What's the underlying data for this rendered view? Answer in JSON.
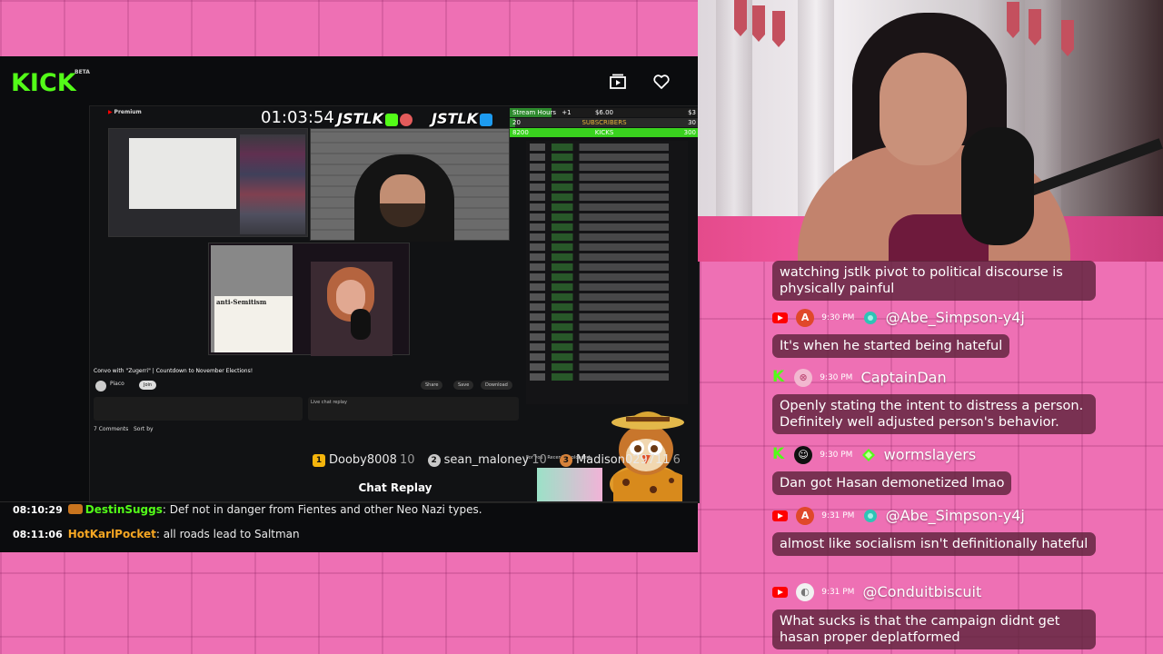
{
  "kick_player": {
    "logo": "KICK",
    "logo_badge": "BETA",
    "icons": {
      "theatre": "theatre-mode-icon",
      "follow": "heart-icon"
    },
    "video": {
      "yt_brand": "Premium",
      "timer": "01:03:54",
      "tag_kick": "JSTLK",
      "tag_twitter": "JSTLK",
      "goals": {
        "hours_label": "Stream Hours",
        "hours_extra": "+1",
        "hours_mid": "$6.00",
        "hours_right": "$3",
        "subs_left": "20",
        "subs_label": "SUBSCRIBERS",
        "subs_right": "30",
        "kicks_left": "8200",
        "kicks_label": "KICKS",
        "kicks_right": "300"
      },
      "pip_doc_title": "anti-Semitism",
      "video_title": "Convo with \"Zugerri\" | Countdown to November Elections!",
      "channel_name": "Piaco",
      "join_label": "Join",
      "share_label": "Share",
      "save_label": "Save",
      "download_label": "Download",
      "live_replay_label": "Live chat replay",
      "comments_count": "7 Comments",
      "sort_label": "Sort by",
      "for_you_label": "For you",
      "recently_uploaded_label": "Recently uploaded"
    },
    "leaderboard": [
      {
        "rank": "1",
        "name": "Dooby8008",
        "score": "10",
        "color": "#f5b50c"
      },
      {
        "rank": "2",
        "name": "sean_maloney",
        "score": "10",
        "color": "#c9c9c9"
      },
      {
        "rank": "3",
        "name": "Madison029711",
        "score": "6",
        "color": "#d6823a"
      }
    ],
    "chat_replay_title": "Chat Replay",
    "replay_messages": [
      {
        "time": "08:10:29",
        "user": "DestinSuggs",
        "user_color": "#53fc18",
        "text": ": Def not in danger from Fientes and other Neo Nazi types."
      },
      {
        "time": "08:11:06",
        "user": "HotKarlPocket",
        "user_color": "#f5a623",
        "text": ": all roads lead to Saltman"
      }
    ]
  },
  "overlay_chat": {
    "messages": [
      {
        "platform": "",
        "avatar": "",
        "time": "",
        "name": "",
        "text": "watching jstlk pivot to political discourse is physically painful"
      },
      {
        "platform": "youtube",
        "avatar": "A",
        "avatar_color": "#e0482a",
        "time": "9:30 PM",
        "role": "globe",
        "name": "@Abe_Simpson-y4j",
        "text": "It's when he started being hateful"
      },
      {
        "platform": "kick",
        "avatar": "⊗",
        "avatar_color": "#f2b8d0",
        "time": "9:30 PM",
        "role": "",
        "name": "CaptainDan",
        "text": "Openly stating the intent to distress a person. Definitely well adjusted person's behavior."
      },
      {
        "platform": "kick",
        "avatar": "☺",
        "avatar_color": "#111111",
        "time": "9:30 PM",
        "role": "gem",
        "name": "wormslayers",
        "text": "Dan got Hasan demonetized lmao"
      },
      {
        "platform": "youtube",
        "avatar": "A",
        "avatar_color": "#e0482a",
        "time": "9:31 PM",
        "role": "globe",
        "name": "@Abe_Simpson-y4j",
        "text": "almost like socialism isn't definitionally hateful"
      },
      {
        "platform": "youtube",
        "avatar": "◐",
        "avatar_color": "#f1f1f1",
        "time": "9:31 PM",
        "role": "",
        "name": "@Conduitbiscuit",
        "text": "What sucks is that the campaign didnt get hasan proper deplatformed"
      }
    ]
  },
  "colors": {
    "kick_green": "#53fc18",
    "background_pink": "#ee70b4",
    "bubble": "#5f233c"
  }
}
